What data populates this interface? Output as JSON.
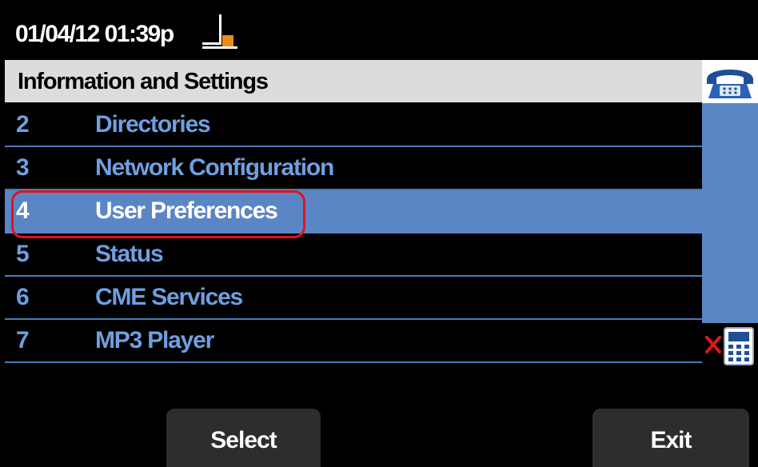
{
  "status_bar": {
    "datetime": "01/04/12 01:39p",
    "line_icon": "line-status-icon"
  },
  "header": {
    "title": "Information and Settings"
  },
  "menu": {
    "items": [
      {
        "number": "2",
        "label": "Directories",
        "selected": false
      },
      {
        "number": "3",
        "label": "Network Configuration",
        "selected": false
      },
      {
        "number": "4",
        "label": "User Preferences",
        "selected": true
      },
      {
        "number": "5",
        "label": "Status",
        "selected": false
      },
      {
        "number": "6",
        "label": "CME Services",
        "selected": false
      },
      {
        "number": "7",
        "label": "MP3 Player",
        "selected": false
      }
    ]
  },
  "side_icons": {
    "top": "phone-icon",
    "bottom": "speaker-mute-icon"
  },
  "softkeys": {
    "select_label": "Select",
    "exit_label": "Exit"
  },
  "colors": {
    "accent_blue": "#5b86c6",
    "menu_text_blue": "#6f9fe0",
    "highlight_red": "#e0141e",
    "line_orange": "#f08a1c"
  }
}
